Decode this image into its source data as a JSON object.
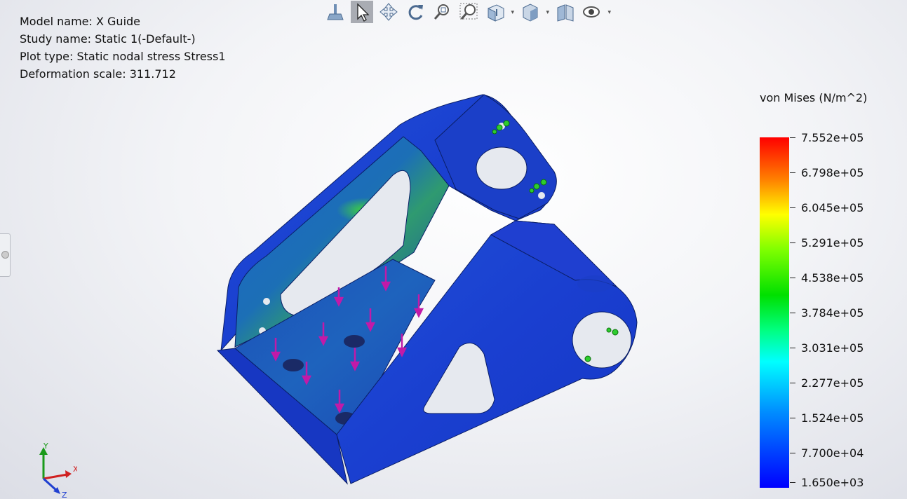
{
  "info": {
    "model_name": "Model name: X Guide",
    "study_name": "Study name: Static 1(-Default-)",
    "plot_type": "Plot type: Static nodal stress Stress1",
    "deformation_scale": "Deformation scale: 311.712"
  },
  "toolbar": {
    "icons": [
      "pushpin-icon",
      "select-arrow-icon",
      "pan-icon",
      "rotate-icon",
      "zoom-to-fit-icon",
      "zoom-to-area-icon",
      "view-orientation-icon",
      "display-style-icon",
      "section-view-icon",
      "hide-show-icon"
    ]
  },
  "legend": {
    "title": "von Mises (N/m^2)",
    "labels": [
      "7.552e+05",
      "6.798e+05",
      "6.045e+05",
      "5.291e+05",
      "4.538e+05",
      "3.784e+05",
      "3.031e+05",
      "2.277e+05",
      "1.524e+05",
      "7.700e+04",
      "1.650e+03"
    ],
    "colors": {
      "max": "#ff0000",
      "mid": "#00e000",
      "min": "#0000ff"
    }
  },
  "triad": {
    "x": "X",
    "y": "Y",
    "z": "Z"
  }
}
